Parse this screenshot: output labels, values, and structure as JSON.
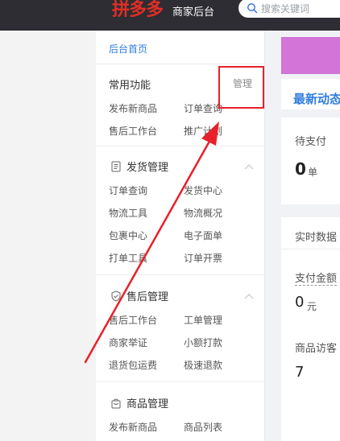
{
  "header": {
    "logo": "拼多多",
    "logo_sub": "商家后台",
    "search_placeholder": "搜索关键词"
  },
  "sidebar": {
    "home": "后台首页",
    "common": {
      "title": "常用功能",
      "manage": "管理",
      "items": [
        "发布新商品",
        "订单查询",
        "售后工作台",
        "推广计划"
      ]
    },
    "shipping": {
      "title": "发货管理",
      "items": [
        "订单查询",
        "发货中心",
        "物流工具",
        "物流概况",
        "包裹中心",
        "电子面单",
        "打单工具",
        "订单开票"
      ]
    },
    "aftersale": {
      "title": "售后管理",
      "items": [
        "售后工作台",
        "工单管理",
        "商家举证",
        "小额打款",
        "退货包运费",
        "极速退款"
      ]
    },
    "goods": {
      "title": "商品管理",
      "items": [
        "发布新商品",
        "商品列表"
      ]
    }
  },
  "main": {
    "news_title": "最新动态",
    "pending": {
      "label": "待支付",
      "value": "0",
      "unit": "单"
    },
    "realtime": {
      "title": "实时数据",
      "pay_label": "支付金额",
      "pay_value": "0",
      "pay_unit": "元",
      "visitor_label": "商品访客",
      "visitor_value": "7"
    }
  },
  "colors": {
    "header_bg": "#2d2d33",
    "brand_red": "#e02e24",
    "link_blue": "#2f7dde",
    "annotation_red": "#e8202a",
    "banner": "#d274d8"
  }
}
